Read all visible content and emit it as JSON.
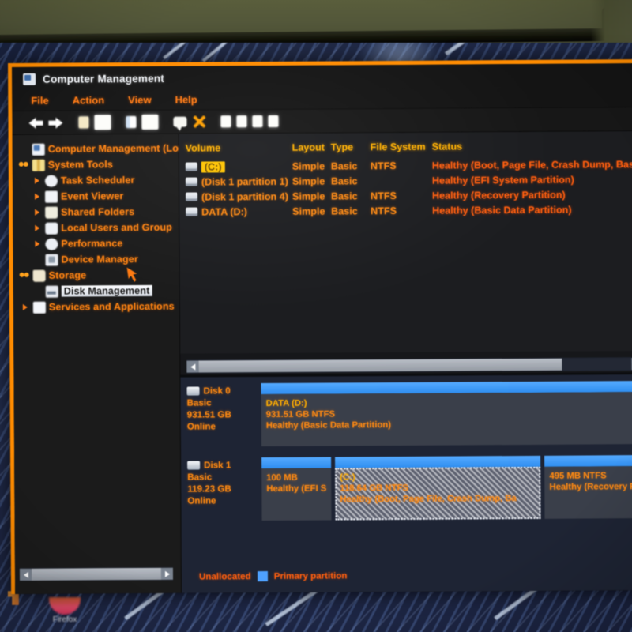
{
  "window": {
    "title": "Computer Management",
    "title_icon": "console-icon"
  },
  "menubar": {
    "items": [
      {
        "label": "File"
      },
      {
        "label": "Action"
      },
      {
        "label": "View"
      },
      {
        "label": "Help"
      }
    ]
  },
  "toolbar": {
    "items": [
      {
        "name": "back-icon"
      },
      {
        "name": "forward-icon"
      },
      {
        "name": "up-folder-icon"
      },
      {
        "name": "show-hide-console-tree-icon"
      },
      {
        "name": "properties-icon"
      },
      {
        "name": "new-window-icon"
      },
      {
        "name": "help-balloon-icon"
      },
      {
        "name": "delete-icon"
      },
      {
        "name": "refresh-icon"
      },
      {
        "name": "export-list-icon"
      },
      {
        "name": "view-icon"
      },
      {
        "name": "extra-icon"
      }
    ]
  },
  "tree": {
    "items": [
      {
        "label": "Computer Management (Loca",
        "icon": "console-icon",
        "indent": 0,
        "expander": "none",
        "selected": false
      },
      {
        "label": "System Tools",
        "icon": "wrench-icon",
        "indent": 1,
        "expander": "open",
        "selected": false
      },
      {
        "label": "Task Scheduler",
        "icon": "clock-icon",
        "indent": 2,
        "expander": "closed",
        "selected": false
      },
      {
        "label": "Event Viewer",
        "icon": "page-icon",
        "indent": 2,
        "expander": "closed",
        "selected": false
      },
      {
        "label": "Shared Folders",
        "icon": "folder-icon",
        "indent": 2,
        "expander": "closed",
        "selected": false
      },
      {
        "label": "Local Users and Group",
        "icon": "users-icon",
        "indent": 2,
        "expander": "closed",
        "selected": false
      },
      {
        "label": "Performance",
        "icon": "performance-icon",
        "indent": 2,
        "expander": "closed",
        "selected": false
      },
      {
        "label": "Device Manager",
        "icon": "device-manager-icon",
        "indent": 2,
        "expander": "none",
        "selected": false
      },
      {
        "label": "Storage",
        "icon": "storage-folder-icon",
        "indent": 1,
        "expander": "open",
        "selected": false
      },
      {
        "label": "Disk Management",
        "icon": "disk-icon",
        "indent": 2,
        "expander": "none",
        "selected": true
      },
      {
        "label": "Services and Applications",
        "icon": "services-icon",
        "indent": 1,
        "expander": "closed",
        "selected": false
      }
    ]
  },
  "volume_list": {
    "columns": [
      "Volume",
      "Layout",
      "Type",
      "File System",
      "Status"
    ],
    "rows": [
      {
        "volume": "(C:)",
        "layout": "Simple",
        "type": "Basic",
        "file_system": "NTFS",
        "status": "Healthy (Boot, Page File, Crash Dump, Basic Da",
        "selected": true
      },
      {
        "volume": "(Disk 1 partition 1)",
        "layout": "Simple",
        "type": "Basic",
        "file_system": "",
        "status": "Healthy (EFI System Partition)",
        "selected": false
      },
      {
        "volume": "(Disk 1 partition 4)",
        "layout": "Simple",
        "type": "Basic",
        "file_system": "NTFS",
        "status": "Healthy (Recovery Partition)",
        "selected": false
      },
      {
        "volume": "DATA (D:)",
        "layout": "Simple",
        "type": "Basic",
        "file_system": "NTFS",
        "status": "Healthy (Basic Data Partition)",
        "selected": false
      }
    ]
  },
  "disk_map": {
    "disks": [
      {
        "name": "Disk 0",
        "type": "Basic",
        "size": "931.51 GB",
        "state": "Online",
        "partitions": [
          {
            "title": "DATA  (D:)",
            "size_line": "931.51 GB NTFS",
            "status_line": "Healthy (Basic Data Partition)",
            "width_pct": 100,
            "selected": false
          }
        ]
      },
      {
        "name": "Disk 1",
        "type": "Basic",
        "size": "119.23 GB",
        "state": "Online",
        "partitions": [
          {
            "title": "",
            "size_line": "100 MB",
            "status_line": "Healthy (EFI S",
            "width_pct": 16,
            "selected": false
          },
          {
            "title": "(C:)",
            "size_line": "118.64 GB NTFS",
            "status_line": "Healthy (Boot, Page File, Crash Dump, Ba",
            "width_pct": 54,
            "selected": true
          },
          {
            "title": "",
            "size_line": "495 MB NTFS",
            "status_line": "Healthy (Recovery P",
            "width_pct": 30,
            "selected": false
          }
        ]
      }
    ]
  },
  "legend": {
    "unallocated_label": "Unallocated",
    "primary_label": "Primary partition"
  },
  "desktop": {
    "firefox_label": "Firefox"
  },
  "colors": {
    "accent_orange": "#ff8a12",
    "header_amber": "#ffb000",
    "status_orange": "#ff5f0f",
    "selection_yellow": "#ffc400",
    "partition_blue": "#4ea1ff",
    "window_border": "#ff8c00"
  }
}
